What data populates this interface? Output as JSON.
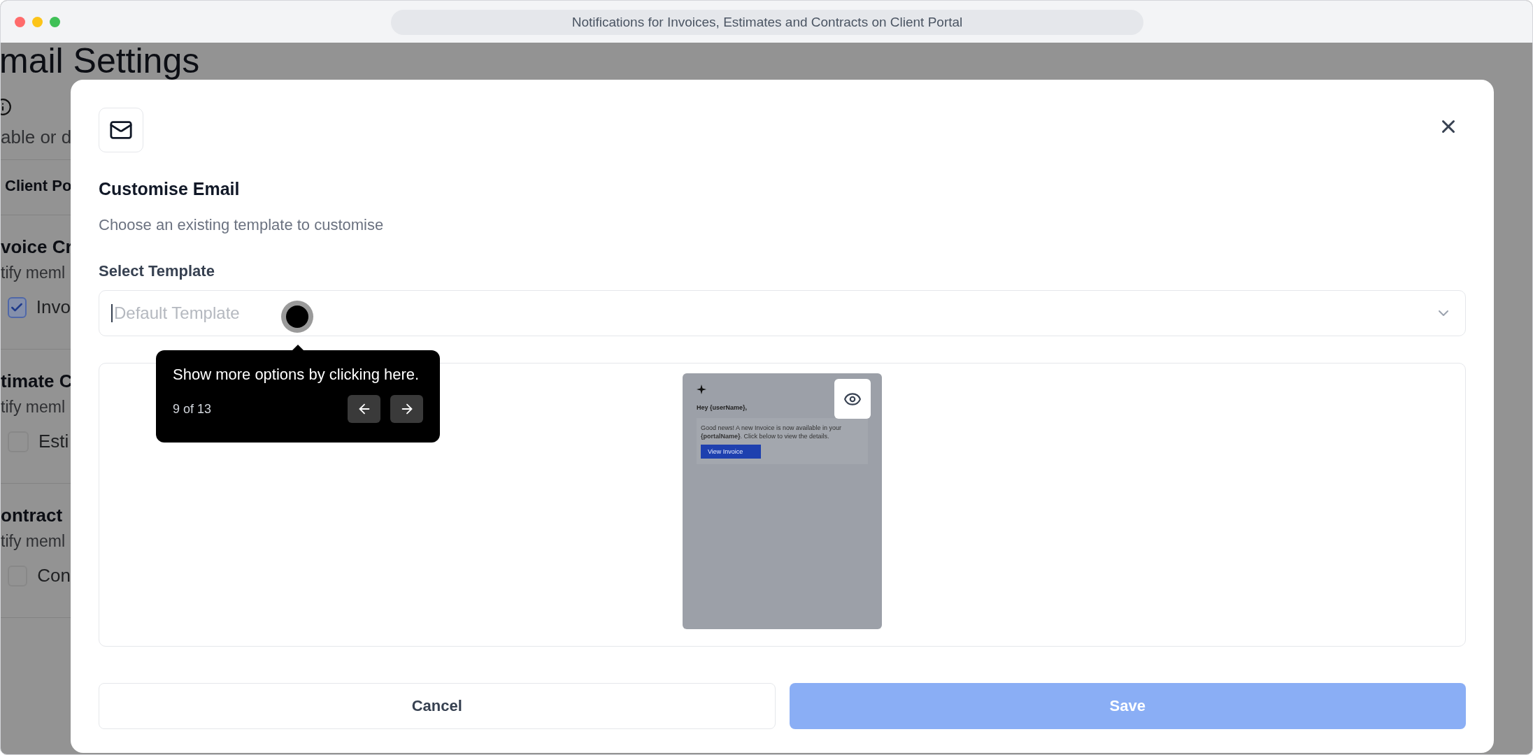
{
  "window": {
    "title": "Notifications for Invoices, Estimates and Contracts on Client Portal"
  },
  "background_page": {
    "title": "mail Settings",
    "description": "able or d",
    "section": "Client Po",
    "groups": [
      {
        "title": "voice Cr",
        "subtitle": "tify meml",
        "option": {
          "label": "Invo",
          "checked": true
        }
      },
      {
        "title": "timate C",
        "subtitle": "tify meml",
        "option": {
          "label": "Esti",
          "checked": false
        }
      },
      {
        "title": "ontract",
        "subtitle": "tify meml",
        "option": {
          "label": "Con",
          "checked": false
        }
      }
    ]
  },
  "modal": {
    "title": "Customise Email",
    "subtitle": "Choose an existing template to customise",
    "field_label": "Select Template",
    "template_select": {
      "placeholder": "Default Template"
    },
    "preview": {
      "greeting": "Hey {userName},",
      "message": "Good news! A new Invoice is now available in your **{portalName}**. Click below to view the details.",
      "button": "View Invoice"
    },
    "buttons": [
      {
        "label": "Cancel",
        "kind": "secondary",
        "disabled": false
      },
      {
        "label": "Save",
        "kind": "primary",
        "disabled": true
      }
    ]
  },
  "tour_tooltip": {
    "text": "Show more options by clicking here.",
    "step": "9 of 13"
  }
}
